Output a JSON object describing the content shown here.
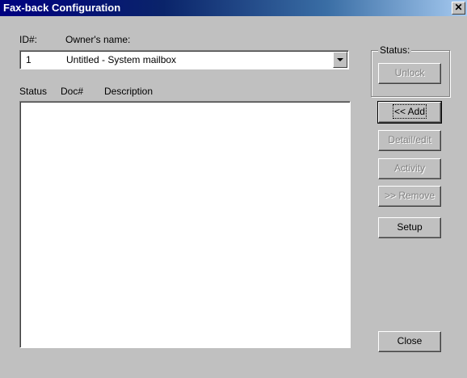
{
  "window": {
    "title": "Fax-back Configuration",
    "close_glyph": "✕"
  },
  "labels": {
    "id": "ID#:",
    "owner": "Owner's name:",
    "status": "Status",
    "doc": "Doc#",
    "description": "Description",
    "status_group": "Status:"
  },
  "mailbox": {
    "id_value": "1",
    "owner_value": "Untitled - System mailbox"
  },
  "buttons": {
    "unlock": "Unlock",
    "add": "<< Add",
    "detail_edit": "Detail/edit",
    "activity": "Activity",
    "remove": ">> Remove",
    "setup": "Setup",
    "close": "Close"
  },
  "colors": {
    "titlebar": "#000080",
    "face": "#c0c0c0"
  }
}
